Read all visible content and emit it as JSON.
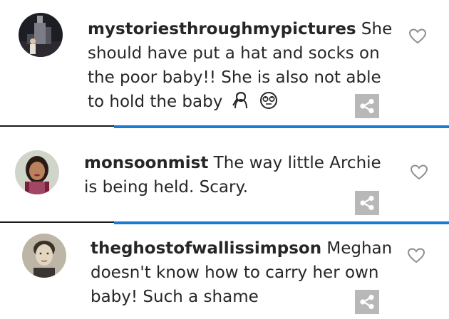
{
  "comments": [
    {
      "username": "mystoriesthroughmypictures",
      "text_line1": " She",
      "text_line2": "should have put a hat and socks on",
      "text_line3": "the poor baby!! She is also not able",
      "text_line4": "to hold the baby",
      "emojis": [
        "woman-facepalming-emoji",
        "face-with-rolling-eyes-emoji"
      ]
    },
    {
      "username": "monsoonmist",
      "text_line1": " The way little Archie",
      "text_line2": "is being held. Scary."
    },
    {
      "username": "theghostofwallissimpson",
      "text_line1": " Meghan",
      "text_line2": "doesn't know how to carry her own",
      "text_line3": "baby! Such a shame"
    }
  ],
  "icons": {
    "like": "heart-outline-icon",
    "share": "share-icon"
  },
  "colors": {
    "text": "#262626",
    "heart": "#8e8e8e",
    "share_bg": "#b8b8b8",
    "divider_blue": "#1a7ad4"
  }
}
